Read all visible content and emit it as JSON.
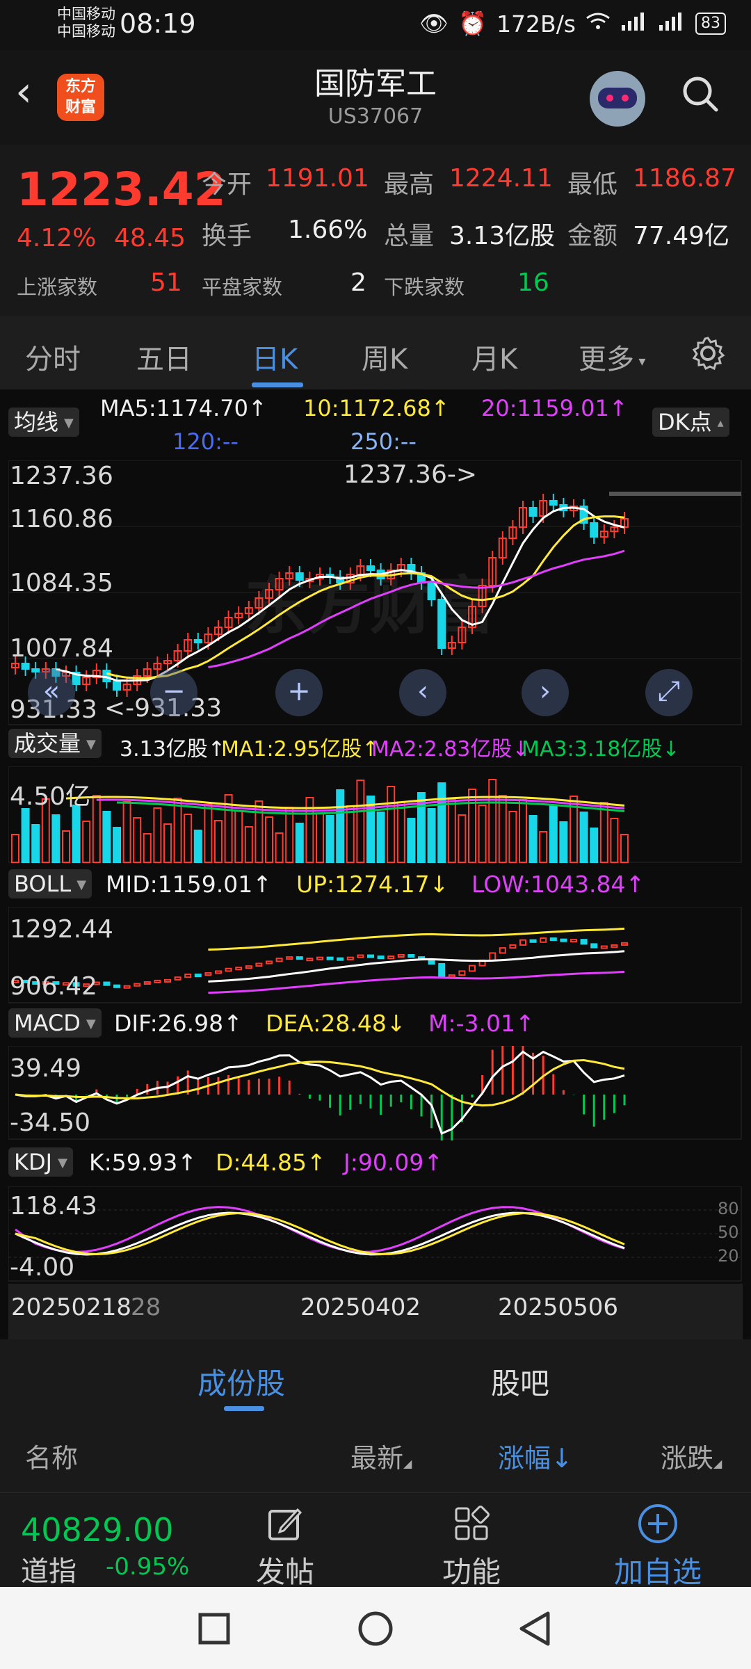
{
  "status_bar": {
    "carrier1": "中国移动",
    "carrier2": "中国移动",
    "time": "08:19",
    "net_speed": "172B/s",
    "battery": "83"
  },
  "header": {
    "title": "国防军工",
    "code": "US37067",
    "logo_line1": "东方",
    "logo_line2": "财富"
  },
  "quote": {
    "price": "1223.42",
    "change_pct": "4.12%",
    "change": "48.45",
    "open_label": "今开",
    "open": "1191.01",
    "high_label": "最高",
    "high": "1224.11",
    "low_label": "最低",
    "low": "1186.87",
    "turnover_label": "换手",
    "turnover": "1.66%",
    "volume_label": "总量",
    "volume": "3.13亿股",
    "amount_label": "金额",
    "amount": "77.49亿",
    "up_label": "上涨家数",
    "up": "51",
    "flat_label": "平盘家数",
    "flat": "2",
    "down_label": "下跌家数",
    "down": "16"
  },
  "tabs": [
    "分时",
    "五日",
    "日K",
    "周K",
    "月K",
    "更多"
  ],
  "active_tab": "日K",
  "ma_row": {
    "selector": "均线",
    "ma5": "MA5:1174.70↑",
    "ma10": "10:1172.68↑",
    "ma20": "20:1159.01↑",
    "ma120": "120:--",
    "ma250": "250:--",
    "dk_button": "DK点"
  },
  "kline_axis": [
    "1237.36",
    "1160.86",
    "1084.35",
    "1007.84",
    "931.33"
  ],
  "kline_high_marker": "1237.36->",
  "kline_low_marker": "<-931.33",
  "volume_row": {
    "selector": "成交量",
    "vol": "3.13亿股↑",
    "ma1": "MA1:2.95亿股↑",
    "ma2": "MA2:2.83亿股↓",
    "ma3": "MA3:3.18亿股↓",
    "axis": "4.50亿"
  },
  "boll_row": {
    "selector": "BOLL",
    "mid": "MID:1159.01↑",
    "up": "UP:1274.17↓",
    "low": "LOW:1043.84↑",
    "axis_top": "1292.44",
    "axis_bottom": "906.42"
  },
  "macd_row": {
    "selector": "MACD",
    "dif": "DIF:26.98↑",
    "dea": "DEA:28.48↓",
    "m": "M:-3.01↑",
    "axis_top": "39.49",
    "axis_bottom": "-34.50"
  },
  "kdj_row": {
    "selector": "KDJ",
    "k": "K:59.93↑",
    "d": "D:44.85↑",
    "j": "J:90.09↑",
    "axis_top": "118.43",
    "axis_bottom": "-4.00",
    "levels": [
      "80",
      "50",
      "20"
    ]
  },
  "dates": [
    "20250218",
    "28",
    "20250402",
    "20250506"
  ],
  "sub_tabs": [
    "成份股",
    "股吧"
  ],
  "active_sub_tab": "成份股",
  "list_headers": {
    "name": "名称",
    "latest": "最新",
    "change_pct": "涨幅↓",
    "change": "涨跌"
  },
  "bottom_bar": {
    "index_value": "40829.00",
    "index_name": "道指",
    "index_change": "-0.95%",
    "post": "发帖",
    "function": "功能",
    "add": "加自选"
  },
  "colors": {
    "up": "#ff3b30",
    "down": "#17d7e8",
    "accent": "#4a90e2",
    "ma5": "#ffffff",
    "ma10": "#ffe93b",
    "ma20": "#e040fb"
  },
  "icons": [
    "back-icon",
    "search-icon",
    "settings-icon",
    "prev-icon",
    "next-icon",
    "zoom-icon",
    "edit-icon",
    "grid-icon",
    "plus-circle-icon"
  ]
}
